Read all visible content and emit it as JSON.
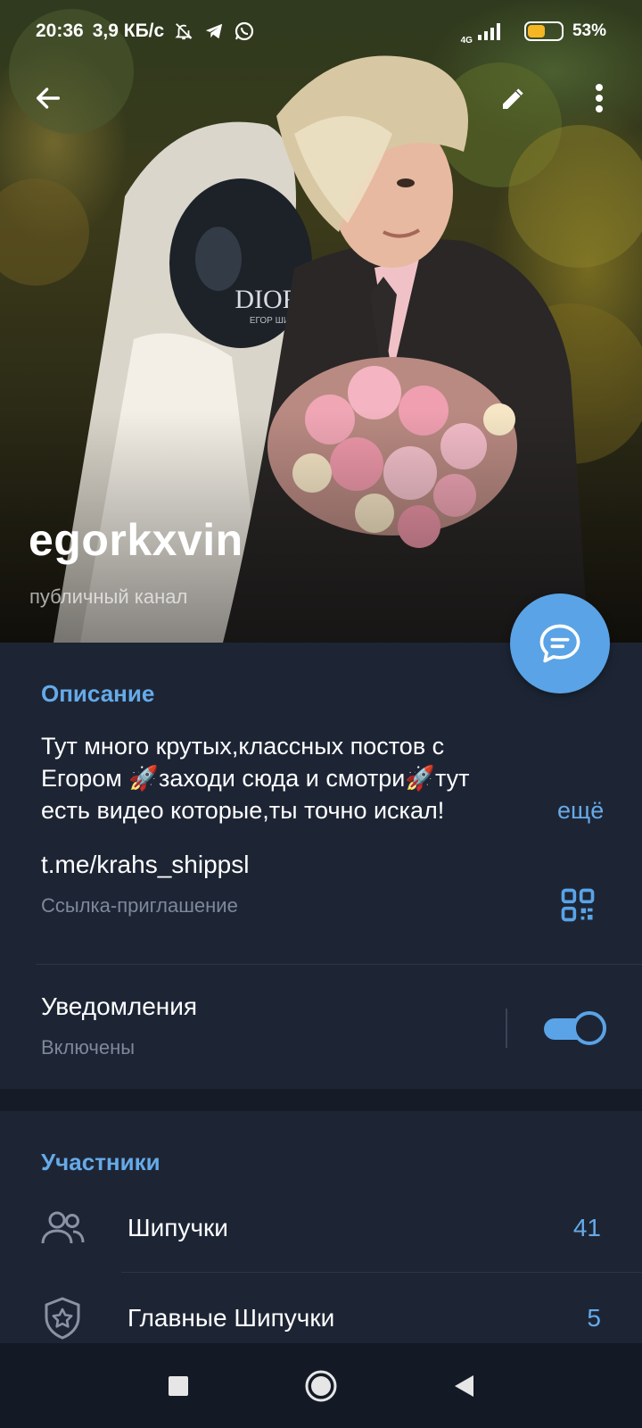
{
  "status_bar": {
    "time": "20:36",
    "speed": "3,9 КБ/с",
    "network": "4G",
    "battery": "53%",
    "battery_level": 0.53,
    "icons": [
      "bell-off-icon",
      "telegram-icon",
      "whatsapp-icon",
      "signal-icon",
      "battery-icon"
    ]
  },
  "toolbar": {
    "back_icon": "arrow-left-icon",
    "edit_icon": "pencil-icon",
    "menu_icon": "more-vertical-icon"
  },
  "channel": {
    "name": "egorkxvin",
    "type": "публичный канал",
    "photo_text": "DIOR",
    "photo_subtext": "ЕГОР ШИП"
  },
  "description": {
    "label": "Описание",
    "line1": "Тут много крутых,классных постов с",
    "line2a": "Егором ",
    "emoji1": "🚀",
    "line2b": "заходи сюда и смотри",
    "emoji2": "🚀",
    "line2c": "тут",
    "line3": "есть видео которые,ты точно искал!",
    "more": "ещё"
  },
  "invite": {
    "link": "t.me/krahs_shippsl",
    "label": "Ссылка-приглашение",
    "icon": "qr-code-icon"
  },
  "notifications": {
    "title": "Уведомления",
    "status": "Включены",
    "enabled": true
  },
  "members": {
    "label": "Участники",
    "rows": [
      {
        "label": "Шипучки",
        "count": "41",
        "icon": "users-icon"
      },
      {
        "label": "Главные Шипучки",
        "count": "5",
        "icon": "admin-shield-icon"
      }
    ]
  },
  "colors": {
    "accent": "#5aa3e6",
    "background": "#1d2535",
    "link_blue": "#66aae8"
  }
}
